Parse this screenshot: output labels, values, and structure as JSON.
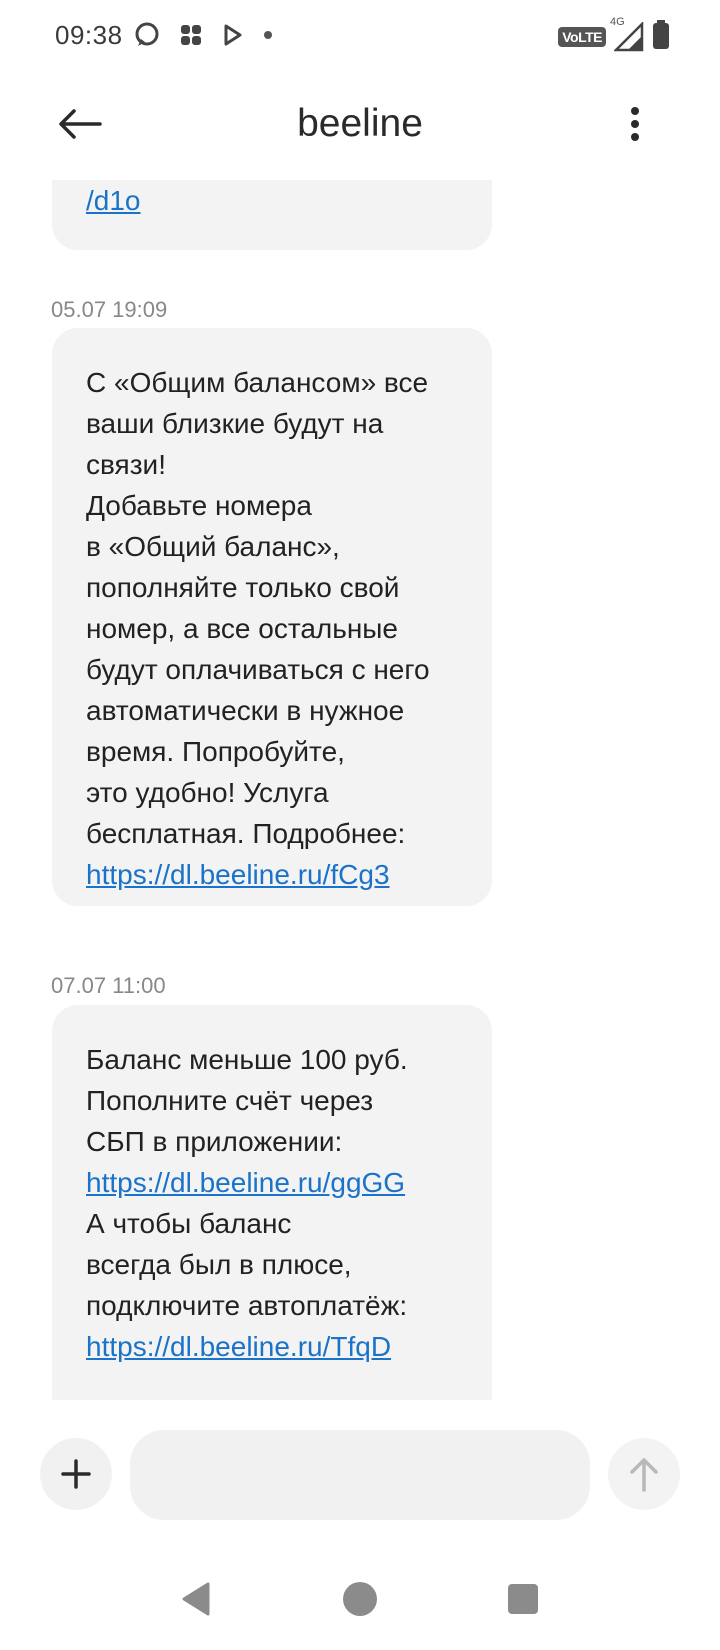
{
  "status_bar": {
    "time": "09:38",
    "volte": "VoLTE",
    "network": "4G"
  },
  "header": {
    "title": "beeline"
  },
  "messages": [
    {
      "timestamp": "",
      "lines": [],
      "link": "/d1o"
    },
    {
      "timestamp": "05.07 19:09",
      "lines": [
        "С «Общим балансом» все",
        "ваши близкие будут на",
        "связи!",
        "Добавьте номера",
        "в «Общий баланс»,",
        "пополняйте только свой",
        "номер, а все остальные",
        "будут оплачиваться с него",
        "автоматически в нужное",
        "время. Попробуйте,",
        "это удобно! Услуга",
        "бесплатная. Подробнее:"
      ],
      "link": "https://dl.beeline.ru/fCg3"
    },
    {
      "timestamp": "07.07 11:00",
      "lines_a": [
        "Баланс меньше 100 руб.",
        "Пополните счёт через",
        "СБП в приложении:"
      ],
      "link_a": "https://dl.beeline.ru/ggGG",
      "lines_b": [
        "А чтобы баланс",
        "всегда был в плюсе,",
        "подключите автоплатёж:"
      ],
      "link_b": "https://dl.beeline.ru/TfqD"
    }
  ],
  "composer": {
    "placeholder": ""
  },
  "icons": {
    "back": "arrow-left-icon",
    "more": "more-vertical-icon",
    "add": "plus-icon",
    "send": "arrow-up-icon"
  }
}
